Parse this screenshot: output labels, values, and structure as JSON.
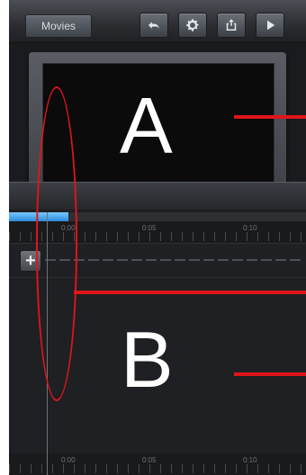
{
  "toolbar": {
    "back_label": "Movies",
    "icons": [
      "undo-icon",
      "gear-icon",
      "share-icon",
      "play-icon"
    ]
  },
  "timeline": {
    "ruler_labels_top": [
      "0:00",
      "0:05",
      "0:10"
    ],
    "ruler_labels_bottom": [
      "0:00",
      "0:05",
      "0:10"
    ]
  },
  "annotations": {
    "label_a": "A",
    "label_b": "B"
  },
  "colors": {
    "annotation_red": "#e0151a",
    "progress_blue": "#2b8ad8",
    "background_dark": "#1f2023"
  },
  "progress": {
    "fraction": 0.2
  }
}
